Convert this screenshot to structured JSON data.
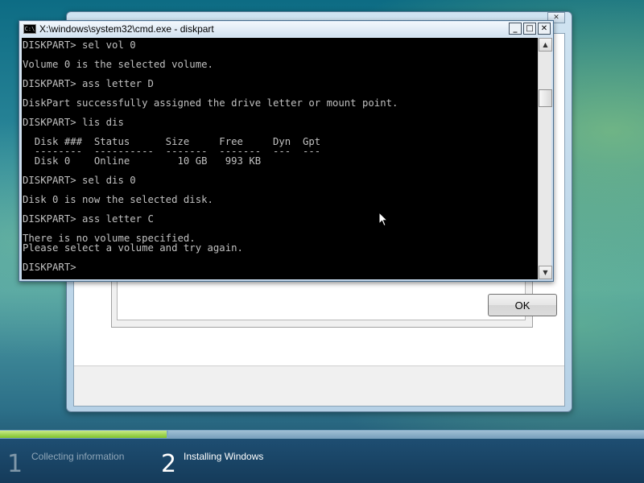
{
  "cmd_window": {
    "title": "X:\\windows\\system32\\cmd.exe - diskpart",
    "icon": "C:\\",
    "minimize_glyph": "_",
    "maximize_glyph": "□",
    "close_glyph": "✕",
    "console_lines": [
      "DISKPART> sel vol 0",
      "",
      "Volume 0 is the selected volume.",
      "",
      "DISKPART> ass letter D",
      "",
      "DiskPart successfully assigned the drive letter or mount point.",
      "",
      "DISKPART> lis dis",
      "",
      "  Disk ###  Status      Size     Free     Dyn  Gpt",
      "  --------  ----------  -------  -------  ---  ---",
      "  Disk 0    Online        10 GB   993 KB",
      "",
      "DISKPART> sel dis 0",
      "",
      "Disk 0 is now the selected disk.",
      "",
      "DISKPART> ass letter C",
      "",
      "There is no volume specified.",
      "Please select a volume and try again.",
      "",
      "DISKPART> "
    ]
  },
  "setup_window": {
    "ok_label": "OK",
    "close_glyph": "✕"
  },
  "progress": {
    "steps": [
      {
        "number": "1",
        "label": "Collecting information",
        "state": "done"
      },
      {
        "number": "2",
        "label": "Installing Windows",
        "state": "current"
      }
    ],
    "colors": {
      "done": "#7fc22c",
      "band": "#1e4e72"
    }
  }
}
